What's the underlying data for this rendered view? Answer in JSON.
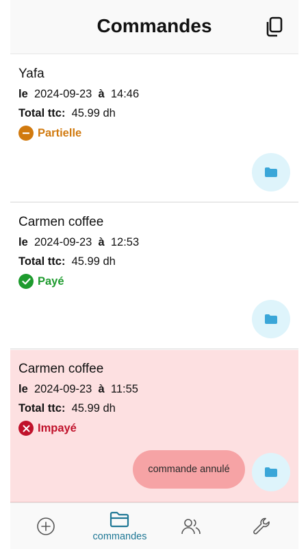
{
  "header": {
    "title": "Commandes"
  },
  "orders": [
    {
      "client": "Yafa",
      "le_label": "le",
      "date": "2024-09-23",
      "a_label": "à",
      "time": "14:46",
      "total_label": "Total ttc:",
      "total_value": "45.99 dh",
      "status": "Partielle",
      "status_color": "#d17a0f"
    },
    {
      "client": "Carmen coffee",
      "le_label": "le",
      "date": "2024-09-23",
      "a_label": "à",
      "time": "12:53",
      "total_label": "Total ttc:",
      "total_value": "45.99 dh",
      "status": "Payé",
      "status_color": "#1e9b2e"
    },
    {
      "client": "Carmen coffee",
      "le_label": "le",
      "date": "2024-09-23",
      "a_label": "à",
      "time": "11:55",
      "total_label": "Total ttc:",
      "total_value": "45.99 dh",
      "status": "Impayé",
      "status_color": "#c0122b",
      "toast": "commande annulé"
    }
  ],
  "bottom_nav": {
    "active_label": "commandes",
    "active_color": "#1e7795",
    "items": [
      "add-icon",
      "folder-icon",
      "users-icon",
      "wrench-icon"
    ]
  },
  "colors": {
    "folder_button_bg": "#def4fb",
    "folder_icon": "#3aa6d8",
    "cancelled_row_bg": "#fde0e1",
    "toast_bg": "#f6a3a5"
  }
}
